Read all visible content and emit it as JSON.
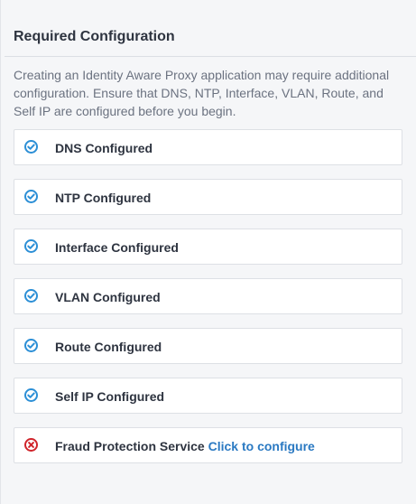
{
  "panel": {
    "title": "Required Configuration",
    "description": "Creating an Identity Aware Proxy application may require additional configuration. Ensure that DNS, NTP, Interface, VLAN, Route, and Self IP are configured before you begin."
  },
  "colors": {
    "ok": "#2c8fd6",
    "error": "#d0242b",
    "link": "#2a79c2"
  },
  "items": [
    {
      "label": "DNS Configured",
      "status": "ok",
      "icon": "check-circle-icon"
    },
    {
      "label": "NTP Configured",
      "status": "ok",
      "icon": "check-circle-icon"
    },
    {
      "label": "Interface Configured",
      "status": "ok",
      "icon": "check-circle-icon"
    },
    {
      "label": "VLAN Configured",
      "status": "ok",
      "icon": "check-circle-icon"
    },
    {
      "label": "Route Configured",
      "status": "ok",
      "icon": "check-circle-icon"
    },
    {
      "label": "Self IP Configured",
      "status": "ok",
      "icon": "check-circle-icon"
    },
    {
      "label": "Fraud Protection Service",
      "status": "error",
      "icon": "x-circle-icon",
      "link_text": "Click to configure"
    }
  ]
}
